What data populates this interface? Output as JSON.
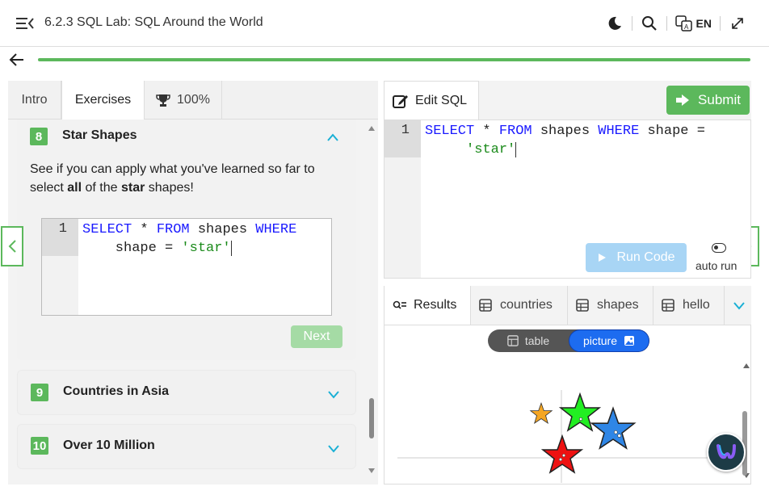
{
  "header": {
    "title": "6.2.3 SQL Lab: SQL Around the World",
    "language": "EN"
  },
  "colors": {
    "accent": "#5cb85c",
    "keyword": "#1a1aff",
    "string": "#1a8a1a",
    "run": "#a8d5f5"
  },
  "left_tabs": [
    {
      "label": "Intro"
    },
    {
      "label": "Exercises"
    },
    {
      "label": "100%"
    }
  ],
  "exercise": {
    "number": "8",
    "title": "Star Shapes",
    "desc_1": "See if you can apply what you've learned so far to",
    "desc_2a": "select ",
    "desc_2b": "all",
    "desc_2c": " of the ",
    "desc_2d": "star",
    "desc_2e": " shapes!",
    "line_number": "1",
    "code_kw1": "SELECT",
    "code_mid1": " * ",
    "code_kw2": "FROM",
    "code_mid2": " shapes ",
    "code_kw3": "WHERE",
    "code_line2a": "    shape = ",
    "code_str": "'star'",
    "next_label": "Next"
  },
  "collapsed": [
    {
      "number": "9",
      "title": "Countries in Asia"
    },
    {
      "number": "10",
      "title": "Over 10 Million"
    }
  ],
  "editor": {
    "tab_label": "Edit SQL",
    "submit_label": "Submit",
    "line_number": "1",
    "kw1": "SELECT",
    "mid1": " * ",
    "kw2": "FROM",
    "mid2": " shapes ",
    "kw3": "WHERE",
    "mid3": " shape =",
    "line2_indent": "     ",
    "str": "'star'",
    "run_label": "Run Code",
    "auto_run": "auto run"
  },
  "result_tabs": [
    {
      "label": "Results"
    },
    {
      "label": "countries"
    },
    {
      "label": "shapes"
    },
    {
      "label": "hello"
    }
  ],
  "view_toggle": {
    "table": "table",
    "picture": "picture"
  },
  "stars": [
    {
      "color": "#f5a623",
      "size": "small"
    },
    {
      "color": "#22ee22",
      "size": "large"
    },
    {
      "color": "#2f86e6",
      "size": "large"
    },
    {
      "color": "#ee1111",
      "size": "large"
    }
  ]
}
